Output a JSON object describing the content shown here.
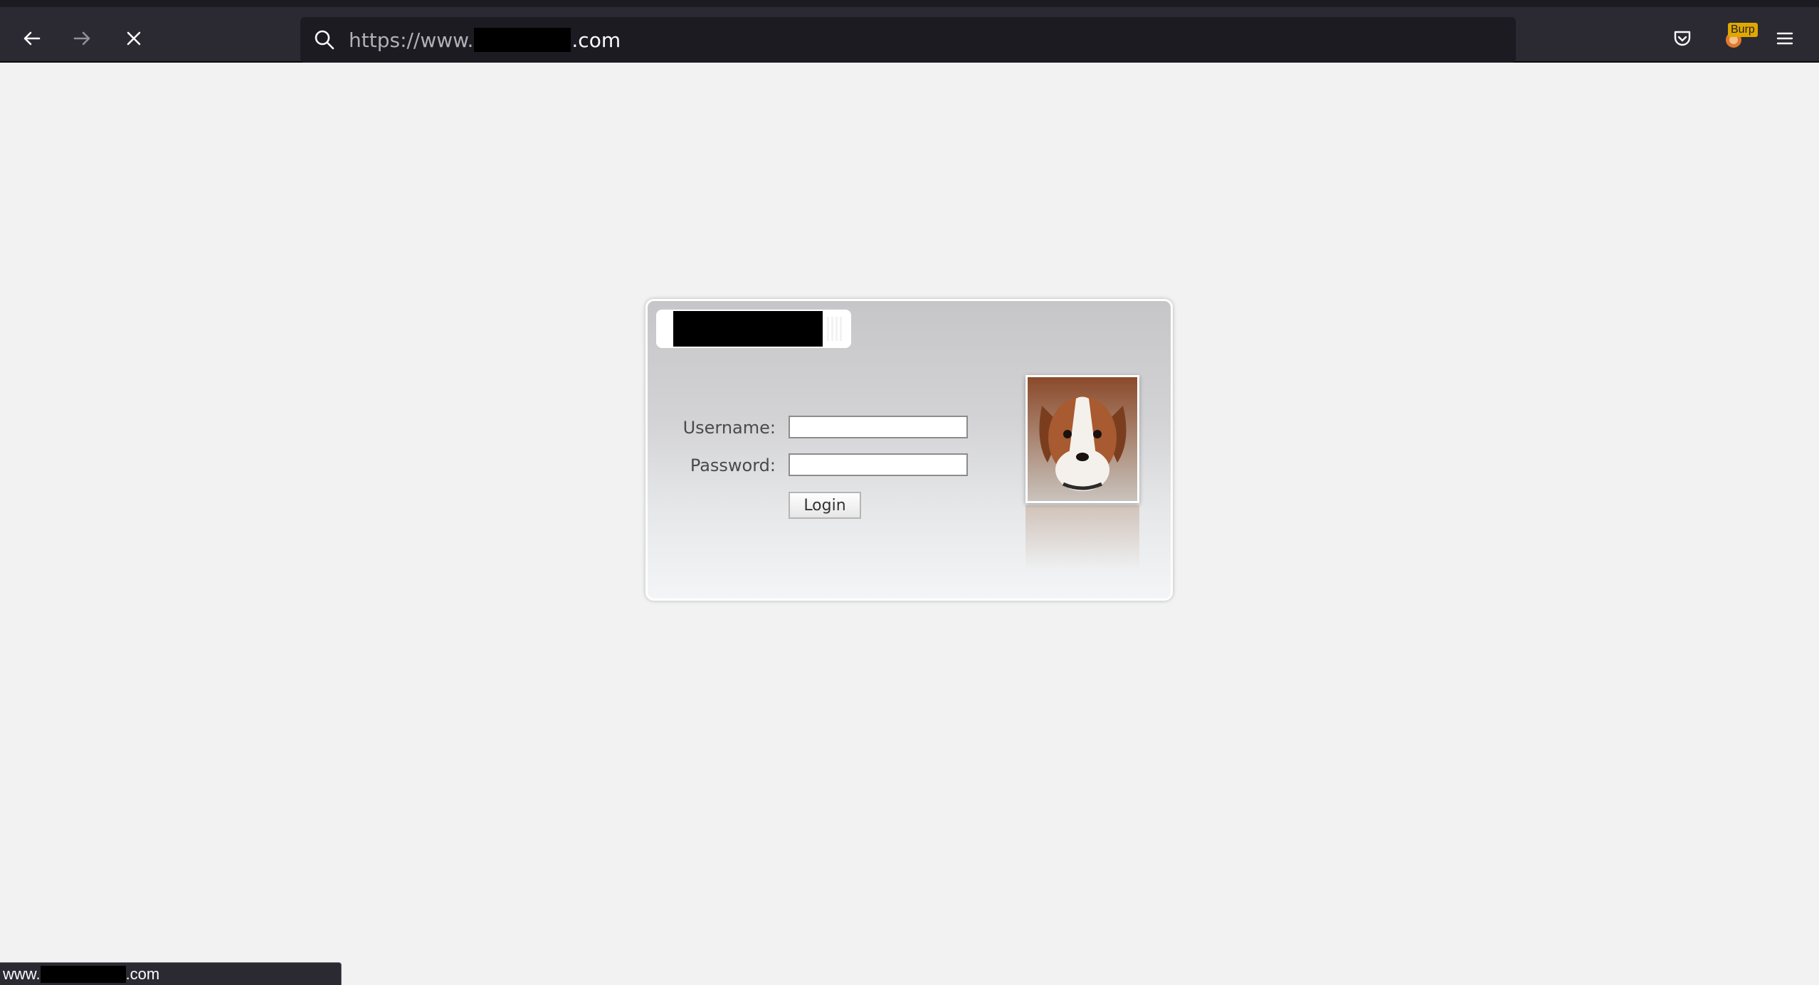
{
  "browser": {
    "url_prefix": "https://www.",
    "url_suffix": ".com",
    "extension_badge": "Burp"
  },
  "login": {
    "username_label": "Username:",
    "password_label": "Password:",
    "username_value": "",
    "password_value": "",
    "login_label": "Login"
  },
  "status": {
    "prefix": "www.",
    "suffix": ".com"
  }
}
